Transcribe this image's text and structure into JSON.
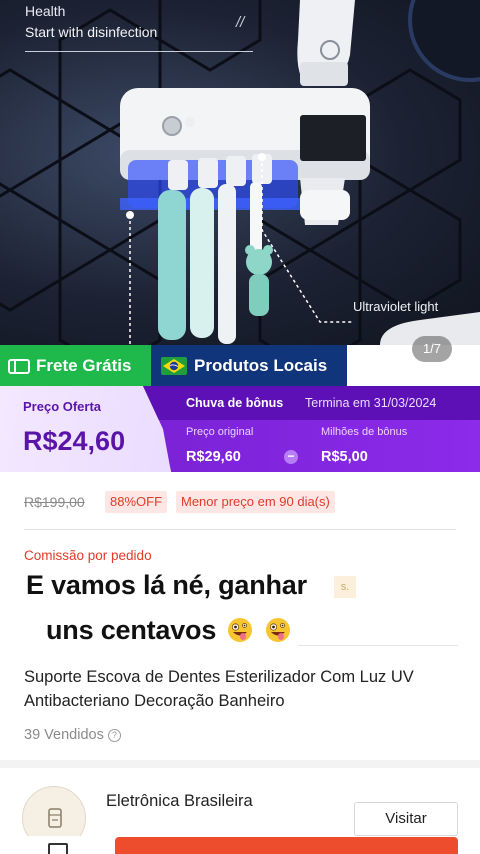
{
  "hero": {
    "health": "Health",
    "subtitle": "Start with disinfection",
    "slash": "//",
    "uv_label": "Ultraviolet light",
    "image_counter": "1/7"
  },
  "badges": {
    "free_shipping": "Frete Grátis",
    "local_products": "Produtos Locais"
  },
  "price": {
    "offer_label": "Preço Oferta",
    "offer_value": "R$24,60",
    "bonus_title": "Chuva de bônus",
    "bonus_ends": "Termina em 31/03/2024",
    "original_label": "Preço original",
    "original_value": "R$29,60",
    "bonus_label": "Milhões de bônus",
    "bonus_value": "R$5,00"
  },
  "details": {
    "old_price": "R$199,00",
    "discount_tag": "88%OFF",
    "lowest_tag": "Menor preço em 90 dia(s)",
    "commission": "Comissão por pedido",
    "faded_chip": "s.",
    "overlay_line1": "E vamos lá  né, ganhar",
    "overlay_line2": "uns centavos",
    "title": "Suporte Escova de Dentes Esterilizador Com Luz UV Antibacteriano Decoração Banheiro",
    "sold": "39 Vendidos",
    "help_symbol": "?"
  },
  "store": {
    "name": "Eletrônica Brasileira",
    "visit": "Visitar"
  },
  "icons": [
    "truck-icon",
    "brazil-flag-icon",
    "minus-icon",
    "help-icon",
    "zany-face-icon",
    "store-icon"
  ],
  "colors": {
    "free_shipping": "#1fb84a",
    "local_products": "#10357a",
    "price_purple": "#5b14a8",
    "bonus_purple": "#8c2bea",
    "accent_red": "#e13b2a",
    "buy_orange": "#ee4d2d"
  }
}
